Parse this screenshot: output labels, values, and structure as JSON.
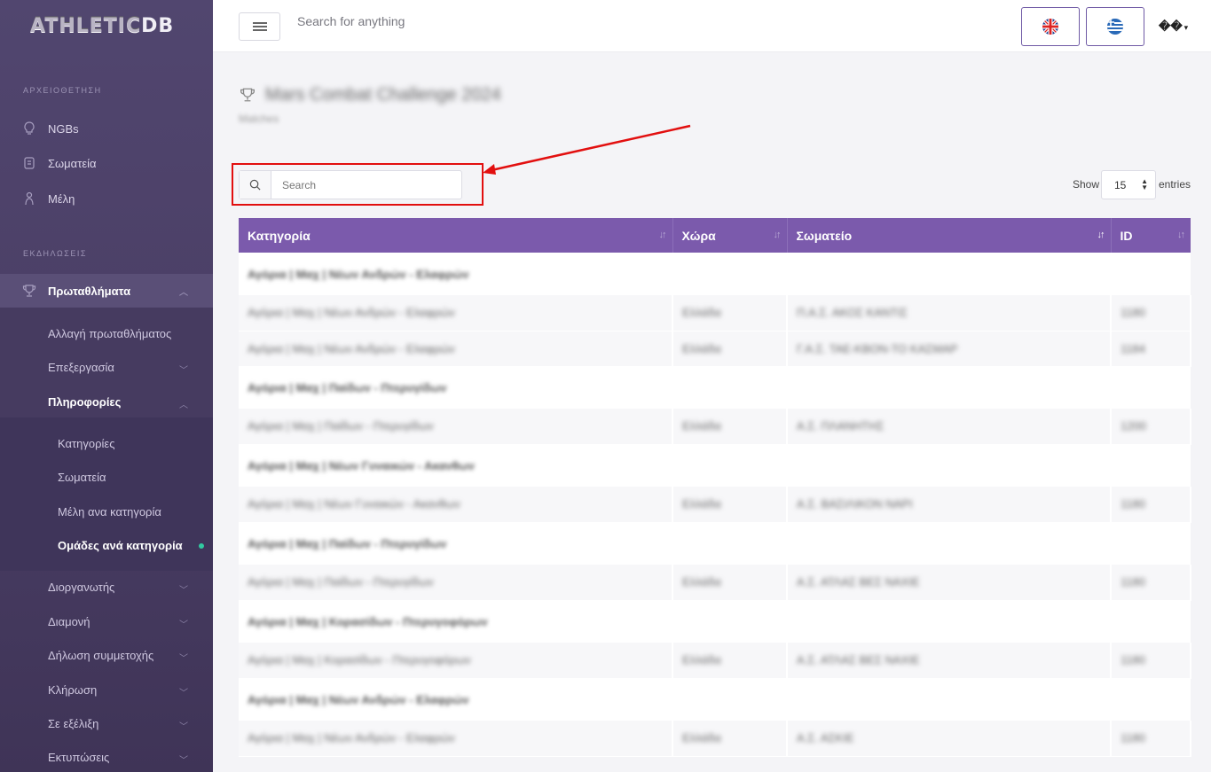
{
  "brand": {
    "part1": "ATHLETIC",
    "part2": "DB"
  },
  "topbar": {
    "search_placeholder": "Search for anything",
    "user_label": "��"
  },
  "sidebar": {
    "section1": "ΑΡΧΕΙΟΘΕΤΗΣΗ",
    "items1": [
      {
        "label": "NGBs",
        "icon": "lightbulb-icon"
      },
      {
        "label": "Σωματεία",
        "icon": "club-icon"
      },
      {
        "label": "Μέλη",
        "icon": "athlete-icon"
      }
    ],
    "section2": "ΕΚΔΗΛΩΣΕΙΣ",
    "championships": "Πρωταθλήματα",
    "sub": {
      "change": "Αλλαγή πρωταθλήματος",
      "edit": "Επεξεργασία",
      "info": "Πληροφορίες"
    },
    "info_items": [
      "Κατηγορίες",
      "Σωματεία",
      "Μέλη ανα κατηγορία",
      "Ομάδες ανά κατηγορία"
    ],
    "more": [
      "Διοργανωτής",
      "Διαμονή",
      "Δήλωση συμμετοχής",
      "Κλήρωση",
      "Σε εξέλιξη",
      "Εκτυπώσεις"
    ]
  },
  "page": {
    "title": "Mars Combat Challenge 2024",
    "subtitle": "Matches"
  },
  "table_controls": {
    "search_placeholder": "Search",
    "show_label": "Show",
    "entries_value": "15",
    "entries_label": "entries"
  },
  "table": {
    "headers": [
      "Κατηγορία",
      "Χώρα",
      "Σωματείο",
      "ID"
    ],
    "groups": [
      {
        "title": "Αγόρια | Μαχ | Νέων Ανδρών - Ελαφρών",
        "rows": [
          {
            "cat": "Αγόρια | Μαχ | Νέων Ανδρών - Ελαφρών",
            "country": "Ελλάδα",
            "club": "Π.Α.Σ. ΑΚΟΣ ΚΑΝΤΙΣ",
            "id": "1180"
          },
          {
            "cat": "Αγόρια | Μαχ | Νέων Ανδρών - Ελαφρών",
            "country": "Ελλάδα",
            "club": "Γ.Α.Σ. ΤΑΕ-ΚΒΟΝ-ΤΟ ΚΑΣΜΑΡ",
            "id": "1184"
          }
        ]
      },
      {
        "title": "Αγόρια | Μαχ | Παίδων - Πτερυγίδων",
        "rows": [
          {
            "cat": "Αγόρια | Μαχ | Παίδων - Πτερυγίδων",
            "country": "Ελλάδα",
            "club": "Α.Σ. ΠΛΑΝΗΤΗΣ",
            "id": "1200"
          }
        ]
      },
      {
        "title": "Αγόρια | Μαχ | Νέων Γυναικών - Ακανθων",
        "rows": [
          {
            "cat": "Αγόρια | Μαχ | Νέων Γυναικών - Ακανθων",
            "country": "Ελλάδα",
            "club": "Α.Σ. ΒΑΣΙΛΙΚΟΝ ΝΑΡΙ",
            "id": "1180"
          }
        ]
      },
      {
        "title": "Αγόρια | Μαχ | Παίδων - Πτερυγίδων",
        "rows": [
          {
            "cat": "Αγόρια | Μαχ | Παίδων - Πτερυγίδων",
            "country": "Ελλάδα",
            "club": "Α.Σ. ΑΤΛΑΣ ΒΕΣ ΝΑΧΙΕ",
            "id": "1180"
          }
        ]
      },
      {
        "title": "Αγόρια | Μαχ | Κορασίδων - Πτερυγοφόρων",
        "rows": [
          {
            "cat": "Αγόρια | Μαχ | Κορασίδων - Πτερυγοφόρων",
            "country": "Ελλάδα",
            "club": "Α.Σ. ΑΤΛΑΣ ΒΕΣ ΝΑΧΙΕ",
            "id": "1180"
          }
        ]
      },
      {
        "title": "Αγόρια | Μαχ | Νέων Ανδρών - Ελαφρών",
        "rows": [
          {
            "cat": "Αγόρια | Μαχ | Νέων Ανδρών - Ελαφρών",
            "country": "Ελλάδα",
            "club": "Α.Σ. ΑΣΚΙΕ",
            "id": "1180"
          }
        ]
      }
    ]
  },
  "colors": {
    "accent": "#7b5aac",
    "annotation": "#e20f0f",
    "active_dot": "#31c9a0"
  }
}
